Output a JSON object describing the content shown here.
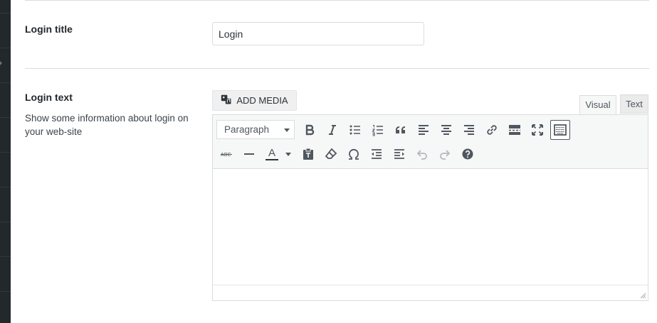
{
  "login_title": {
    "label": "Login title",
    "value": "Login"
  },
  "login_text": {
    "label": "Login text",
    "description": "Show some information about login on your web-site",
    "add_media_label": "ADD MEDIA",
    "tabs": {
      "visual": "Visual",
      "text": "Text"
    },
    "format_select": "Paragraph",
    "toolbar_row1_icons": [
      "bold-icon",
      "italic-icon",
      "bullet-list-icon",
      "numbered-list-icon",
      "blockquote-icon",
      "align-left-icon",
      "align-center-icon",
      "align-right-icon",
      "link-icon",
      "read-more-icon",
      "fullscreen-icon",
      "toolbar-toggle-icon"
    ],
    "toolbar_row2_icons": [
      "strikethrough-icon",
      "horizontal-line-icon",
      "text-color-icon",
      "paste-as-text-icon",
      "clear-formatting-icon",
      "special-character-icon",
      "outdent-icon",
      "indent-icon",
      "undo-icon",
      "redo-icon",
      "help-icon"
    ],
    "text_color_glyph": "A",
    "colors": {
      "toolbar_bg": "#f6f7f7",
      "border": "#dcdcde",
      "icon": "#50575e",
      "disabled_icon": "#b4b9be"
    }
  }
}
